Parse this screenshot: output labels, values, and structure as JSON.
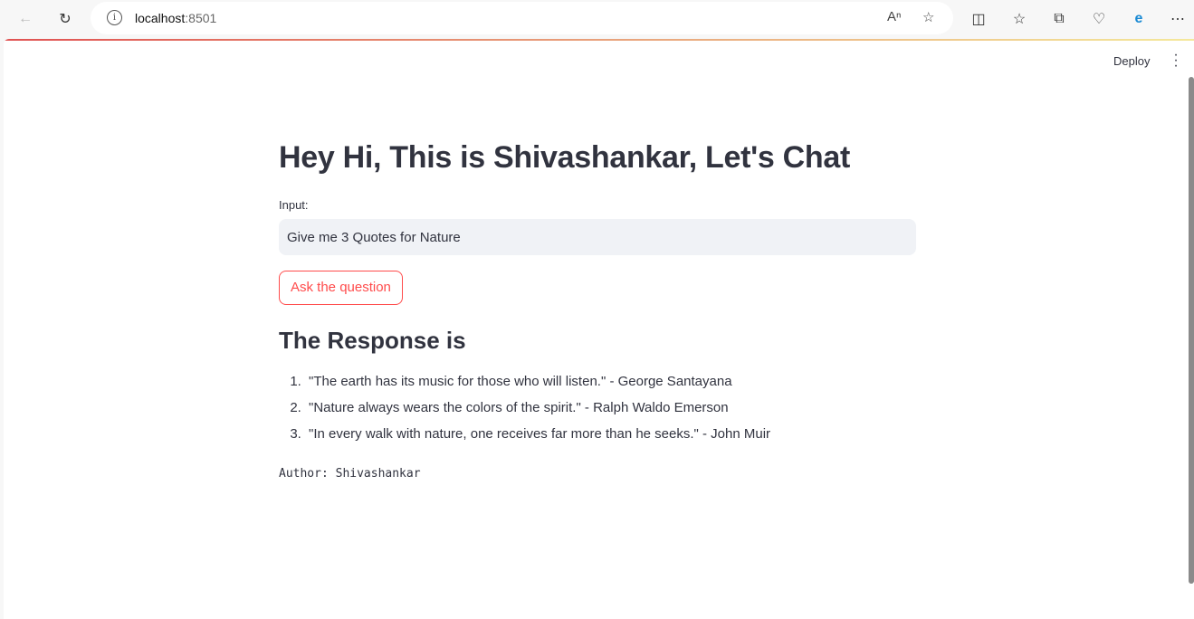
{
  "browser": {
    "url_host": "localhost",
    "url_port": ":8501",
    "icons": [
      "back-icon",
      "refresh-icon",
      "info-icon",
      "read-aloud-icon",
      "favorite-star-icon",
      "split-screen-icon",
      "favorites-icon",
      "collections-icon",
      "browser-essentials-icon",
      "edge-icon",
      "more-icon"
    ]
  },
  "header": {
    "deploy_label": "Deploy"
  },
  "app": {
    "title": "Hey Hi, This is Shivashankar, Let's Chat",
    "input_label": "Input:",
    "input_value": "Give me 3 Quotes for Nature",
    "button_label": "Ask the question",
    "response_heading": "The Response is",
    "response_items": [
      "\"The earth has its music for those who will listen.\" - George Santayana",
      "\"Nature always wears the colors of the spirit.\" - Ralph Waldo Emerson",
      "\"In every walk with nature, one receives far more than he seeks.\" - John Muir"
    ],
    "author": "Author: Shivashankar"
  },
  "colors": {
    "accent": "#ff4b4b",
    "text": "#31333f",
    "input_bg": "#f0f2f6"
  }
}
